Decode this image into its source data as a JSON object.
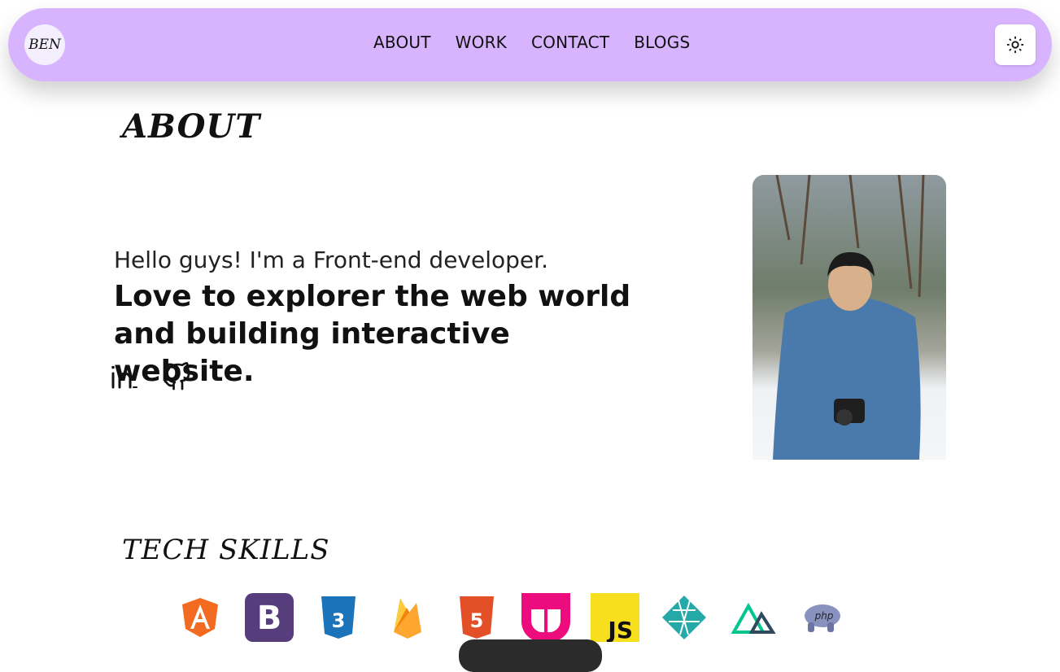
{
  "nav": {
    "logo_text": "BEN",
    "links": [
      "ABOUT",
      "WORK",
      "CONTACT",
      "BLOGS"
    ],
    "theme_icon": "sun-icon",
    "background_color": "#d8b4fe"
  },
  "about": {
    "title": "ABOUT",
    "intro_line1": "Hello guys! I'm a Front-end developer.",
    "intro_line2": "Love to explorer the web world and building interactive website.",
    "socials": [
      "linkedin-icon",
      "github-icon"
    ]
  },
  "skills": {
    "title": "TECH SKILLS",
    "icons": [
      "angular-icon",
      "bootstrap-icon",
      "css3-icon",
      "firebase-icon",
      "html5-icon",
      "jest-icon",
      "javascript-icon",
      "netlify-icon",
      "nuxt-icon",
      "php-icon"
    ]
  }
}
